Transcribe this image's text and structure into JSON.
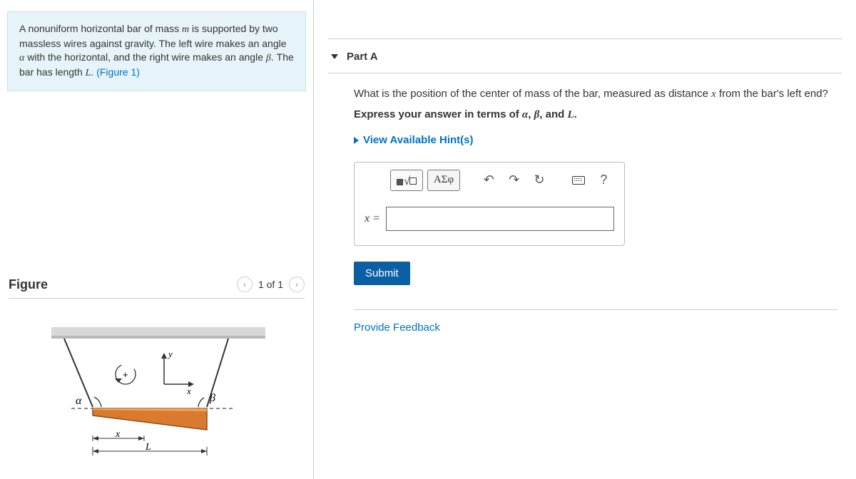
{
  "problem": {
    "text_parts": {
      "p1": "A nonuniform horizontal bar of mass ",
      "m": "m",
      "p2": " is supported by two massless wires against gravity. The left wire makes an angle ",
      "alpha": "α",
      "p3": " with the horizontal, and the right wire makes an angle ",
      "beta": "β",
      "p4": ". The bar has length ",
      "L": "L",
      "p5": ". ",
      "figlink": "(Figure 1)"
    }
  },
  "figure": {
    "title": "Figure",
    "nav_label": "1 of 1",
    "labels": {
      "alpha": "α",
      "beta": "β",
      "x_axis": "x",
      "y_axis": "y",
      "x_dim": "x",
      "L_dim": "L",
      "plus": "+"
    }
  },
  "partA": {
    "title": "Part A",
    "question_parts": {
      "q1": "What is the position of the center of mass of the bar, measured as distance ",
      "x": "x",
      "q2": " from the bar's left end?"
    },
    "instruction_parts": {
      "i1": "Express your answer in terms of ",
      "alpha": "α",
      "comma1": ", ",
      "beta": "β",
      "comma2": ", and ",
      "L": "L",
      "period": "."
    },
    "hints_label": "View Available Hint(s)",
    "toolbar": {
      "greek_label": "ΑΣφ",
      "help_label": "?"
    },
    "eq_label": "x =",
    "answer_value": "",
    "submit_label": "Submit"
  },
  "feedback": {
    "link": "Provide Feedback"
  }
}
